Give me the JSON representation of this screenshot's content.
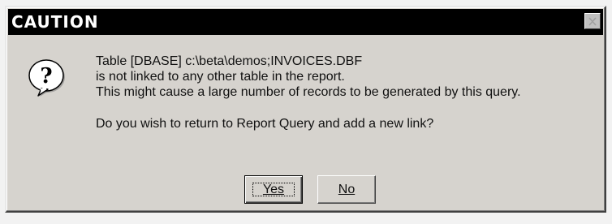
{
  "dialog": {
    "title": "CAUTION",
    "close_icon": "close-icon",
    "icon": "question-icon",
    "message_lines": [
      "Table [DBASE] c:\\beta\\demos;INVOICES.DBF",
      "is not linked to any other table in the report.",
      "This might cause a large number of records to be generated by this query."
    ],
    "prompt": "Do you wish to return to Report Query and add a new link?",
    "buttons": {
      "yes_label": "Yes",
      "no_label": "No"
    }
  }
}
